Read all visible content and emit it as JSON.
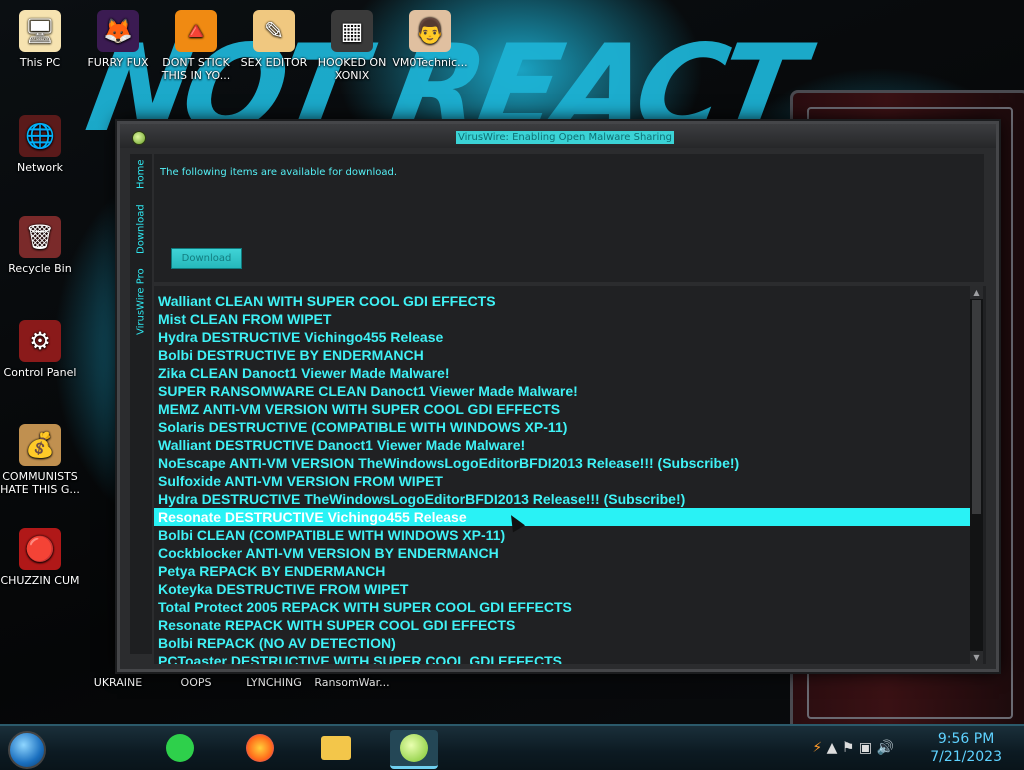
{
  "desktop": {
    "icons": [
      {
        "label": "This PC",
        "glyph": "🖥"
      },
      {
        "label": "FURRY FUX",
        "glyph": "🦊"
      },
      {
        "label": "DONT STICK THIS IN YO...",
        "glyph": "🔺"
      },
      {
        "label": "SEX EDITOR",
        "glyph": "✎"
      },
      {
        "label": "HOOKED ON XONIX",
        "glyph": "▦"
      },
      {
        "label": "VM0Technic...",
        "glyph": "👨"
      },
      {
        "label": "Network",
        "glyph": "🌐"
      },
      {
        "label": "Recycle Bin",
        "glyph": "🗑"
      },
      {
        "label": "Control Panel",
        "glyph": "⚙"
      },
      {
        "label": "COMMUNISTS HATE THIS G...",
        "glyph": "💰"
      },
      {
        "label": "CHUZZIN CUM",
        "glyph": "🔴"
      },
      {
        "label": "UKRAINE",
        "glyph": "◆"
      },
      {
        "label": "OOPS",
        "glyph": "●"
      },
      {
        "label": "LYNCHING",
        "glyph": "●"
      },
      {
        "label": "RansomWar...",
        "glyph": "●"
      }
    ],
    "wallpaper_text": "NOT REACT"
  },
  "window": {
    "title": "VirusWire: Enabling Open Malware Sharing",
    "tabs": [
      "Home",
      "Download",
      "VirusWire Pro"
    ],
    "intro": "The following items are available for download.",
    "download_label": "Download",
    "selected_index": 12,
    "items": [
      "Walliant CLEAN WITH SUPER COOL GDI EFFECTS",
      "Mist CLEAN FROM WIPET",
      "Hydra DESTRUCTIVE Vichingo455 Release",
      "Bolbi DESTRUCTIVE BY ENDERMANCH",
      "Zika CLEAN Danoct1 Viewer Made Malware!",
      "SUPER RANSOMWARE CLEAN Danoct1 Viewer Made Malware!",
      "MEMZ ANTI-VM VERSION WITH SUPER COOL GDI EFFECTS",
      "Solaris DESTRUCTIVE (COMPATIBLE WITH WINDOWS XP-11)",
      "Walliant DESTRUCTIVE Danoct1 Viewer Made Malware!",
      "NoEscape ANTI-VM VERSION TheWindowsLogoEditorBFDI2013 Release!!! (Subscribe!)",
      "Sulfoxide ANTI-VM VERSION FROM WIPET",
      "Hydra DESTRUCTIVE TheWindowsLogoEditorBFDI2013 Release!!! (Subscribe!)",
      "Resonate DESTRUCTIVE Vichingo455 Release",
      "Bolbi CLEAN (COMPATIBLE WITH WINDOWS XP-11)",
      "Cockblocker ANTI-VM VERSION BY ENDERMANCH",
      "Petya REPACK BY ENDERMANCH",
      "Koteyka DESTRUCTIVE FROM WIPET",
      "Total Protect 2005 REPACK WITH SUPER COOL GDI EFFECTS",
      "Resonate REPACK WITH SUPER COOL GDI EFFECTS",
      "Bolbi REPACK (NO AV DETECTION)",
      "PCToaster DESTRUCTIVE WITH SUPER COOL GDI EFFECTS"
    ]
  },
  "taskbar": {
    "time": "9:56 PM",
    "date": "7/21/2023"
  },
  "colors": {
    "accent": "#3ff2f6",
    "selection": "#29f2f5",
    "window_bg": "#202123"
  }
}
